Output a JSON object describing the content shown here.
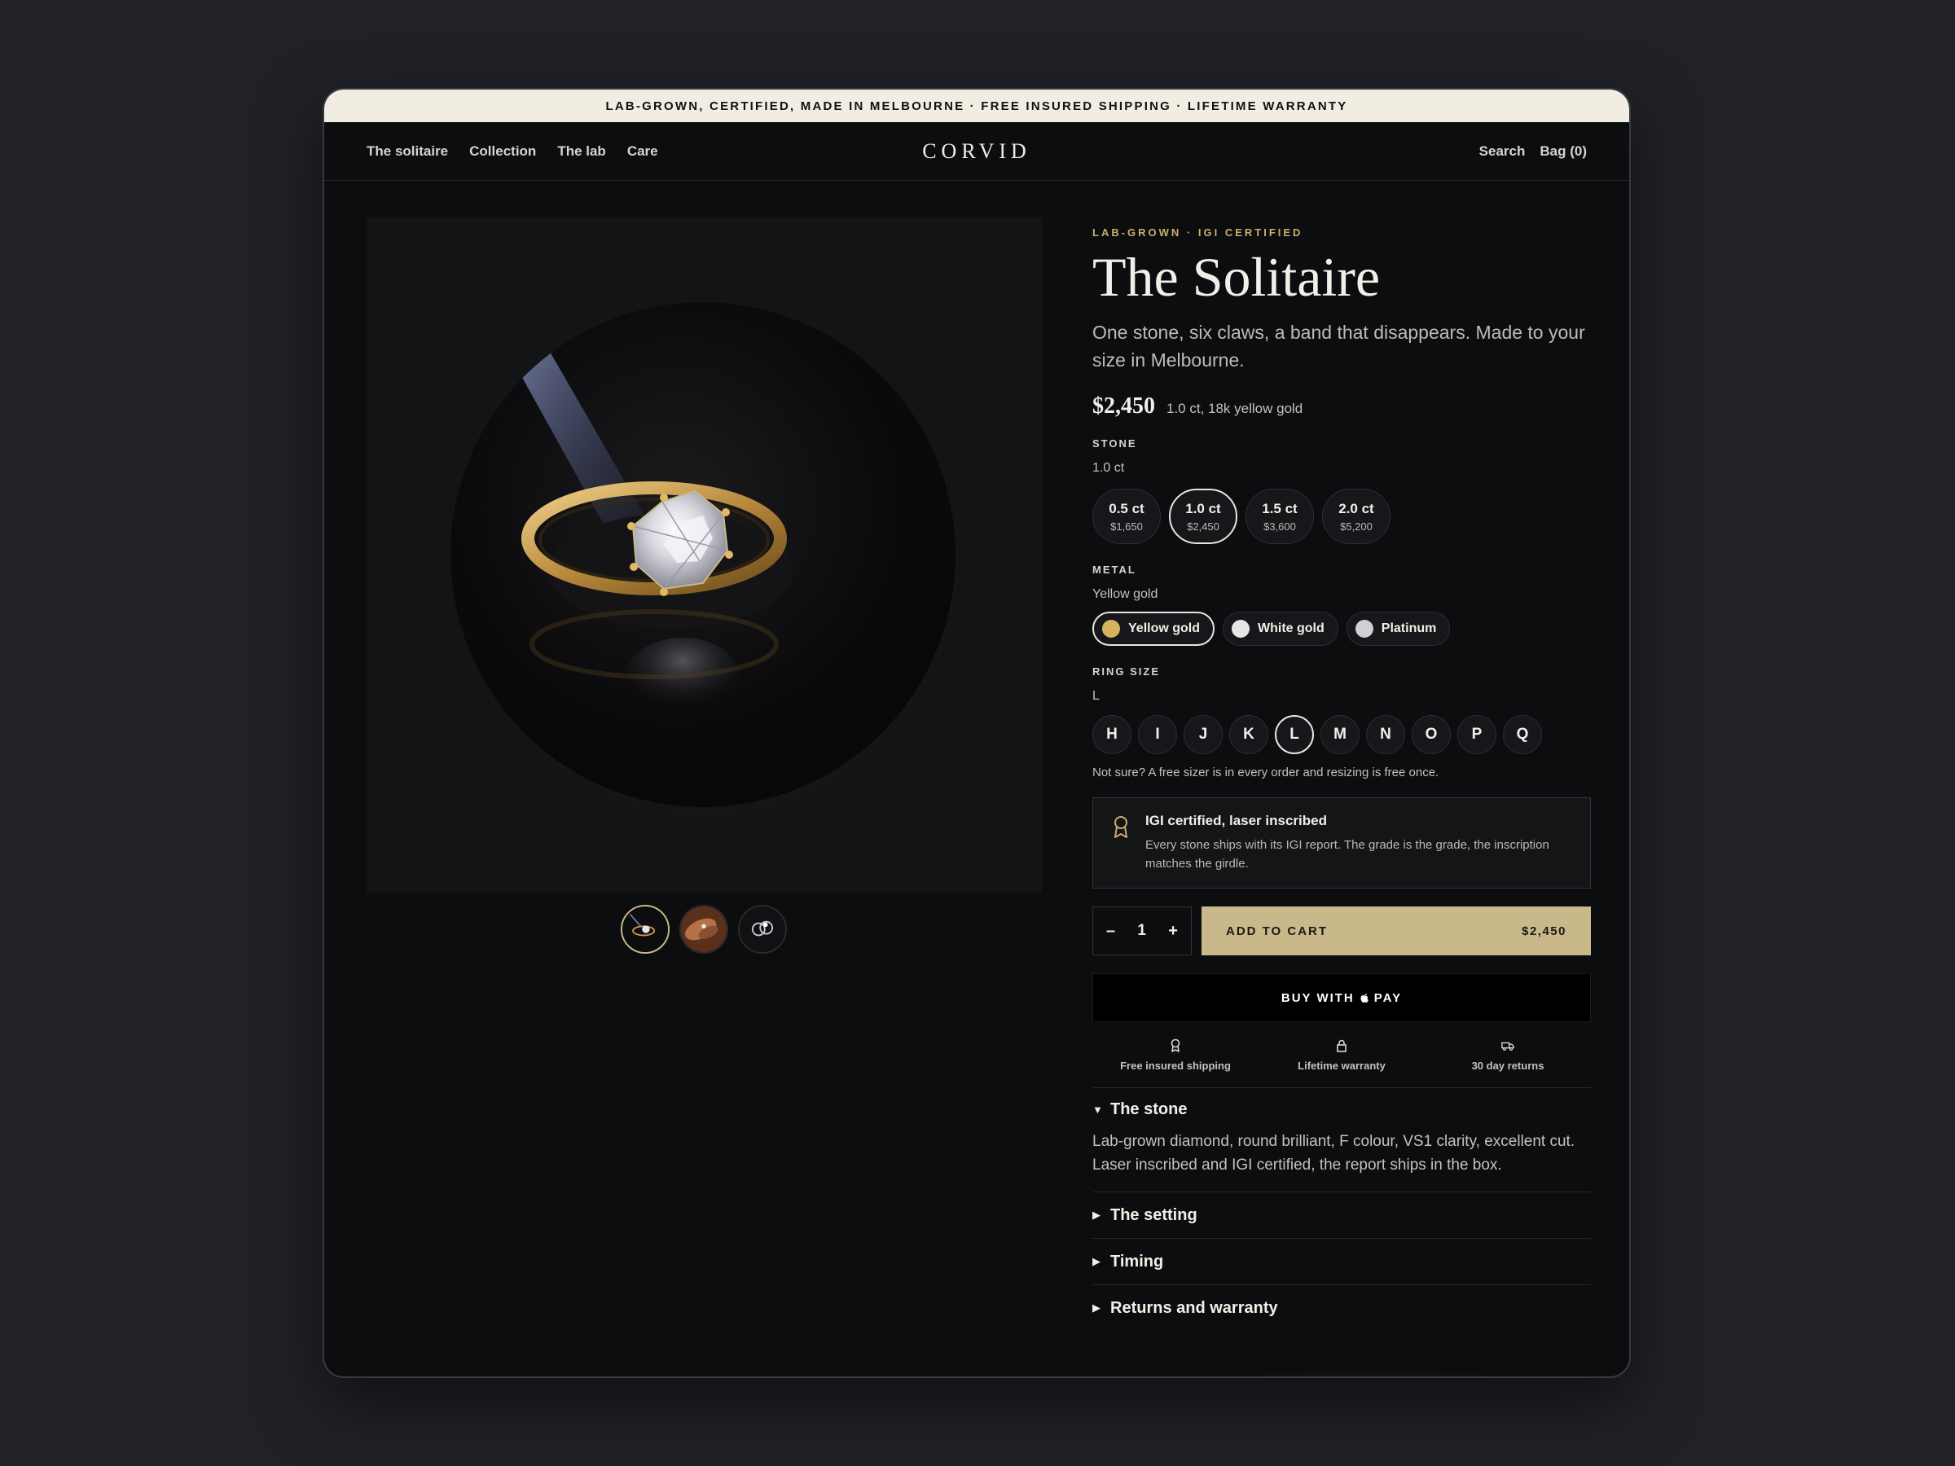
{
  "announcement": "LAB-GROWN, CERTIFIED, MADE IN MELBOURNE · FREE INSURED SHIPPING · LIFETIME WARRANTY",
  "nav": {
    "links": [
      "The solitaire",
      "Collection",
      "The lab",
      "Care"
    ],
    "brand": "CORVID",
    "search": "Search",
    "bag": "Bag (0)"
  },
  "gallery": {
    "thumbnails": [
      "ring-on-dark",
      "ring-on-hand",
      "ring-pair"
    ],
    "active_thumbnail": 0
  },
  "product": {
    "eyebrow": "LAB-GROWN · IGI CERTIFIED",
    "title": "The Solitaire",
    "subtitle": "One stone, six claws, a band that disappears. Made to your size in Melbourne.",
    "price": "$2,450",
    "price_note": "1.0 ct, 18k yellow gold"
  },
  "stone": {
    "label": "STONE",
    "selected": "1.0 ct",
    "options": [
      {
        "ct": "0.5 ct",
        "price": "$1,650"
      },
      {
        "ct": "1.0 ct",
        "price": "$2,450"
      },
      {
        "ct": "1.5 ct",
        "price": "$3,600"
      },
      {
        "ct": "2.0 ct",
        "price": "$5,200"
      }
    ]
  },
  "metal": {
    "label": "METAL",
    "selected": "Yellow gold",
    "options": [
      {
        "name": "Yellow gold",
        "color": "#d6b25e"
      },
      {
        "name": "White gold",
        "color": "#e6e6e6"
      },
      {
        "name": "Platinum",
        "color": "#cfd0d3"
      }
    ]
  },
  "ring_size": {
    "label": "RING SIZE",
    "selected": "L",
    "options": [
      "H",
      "I",
      "J",
      "K",
      "L",
      "M",
      "N",
      "O",
      "P",
      "Q"
    ],
    "note": "Not sure? A free sizer is in every order and resizing is free once."
  },
  "certificate": {
    "title": "IGI certified, laser inscribed",
    "body": "Every stone ships with its IGI report. The grade is the grade, the inscription matches the girdle."
  },
  "cart": {
    "qty_minus": "–",
    "qty": "1",
    "qty_plus": "+",
    "add_label": "ADD TO CART",
    "add_price": "$2,450",
    "pay_prefix": "BUY WITH",
    "pay_suffix": "PAY"
  },
  "perks": [
    "Free insured shipping",
    "Lifetime warranty",
    "30 day returns"
  ],
  "accordion": [
    {
      "title": "The stone",
      "open": true,
      "body": "Lab-grown diamond, round brilliant, F colour, VS1 clarity, excellent cut. Laser inscribed and IGI certified, the report ships in the box."
    },
    {
      "title": "The setting",
      "open": false
    },
    {
      "title": "Timing",
      "open": false
    },
    {
      "title": "Returns and warranty",
      "open": false
    }
  ],
  "colors": {
    "accent_gold": "#c9b98a",
    "eyebrow_gold": "#c9ae6e",
    "background": "#0c0d0e",
    "announcement_bg": "#f1ede3"
  }
}
